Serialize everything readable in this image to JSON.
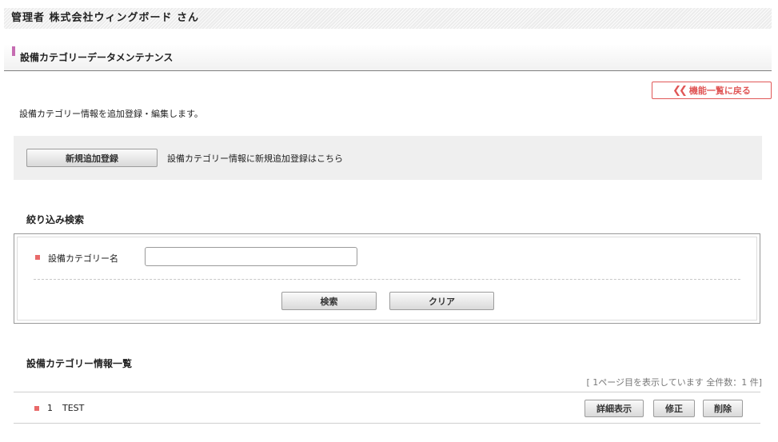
{
  "header": {
    "user_text": "管理者 株式会社ウィングボード さん"
  },
  "page": {
    "title": "設備カテゴリーデータメンテナンス"
  },
  "nav": {
    "back_label": "機能一覧に戻る"
  },
  "intro": "設備カテゴリー情報を追加登録・編集します。",
  "add": {
    "button_label": "新規追加登録",
    "description": "設備カテゴリー情報に新規追加登録はこちら"
  },
  "search": {
    "title": "絞り込み検索",
    "field_label": "設備カテゴリー名",
    "field_value": "",
    "search_label": "検索",
    "clear_label": "クリア"
  },
  "list": {
    "title": "設備カテゴリー情報一覧",
    "count_text": "[ 1ページ目を表示しています 全件数：1 件]",
    "rows": [
      {
        "index": "1",
        "name": "TEST"
      }
    ],
    "detail_label": "詳細表示",
    "edit_label": "修正",
    "delete_label": "削除"
  },
  "colors": {
    "accent": "#c66cb2",
    "bullet": "#e96a6a",
    "back_button": "#e05757"
  },
  "icons": {
    "back": "double-chevron-left-icon",
    "bullet": "square-bullet-icon"
  }
}
